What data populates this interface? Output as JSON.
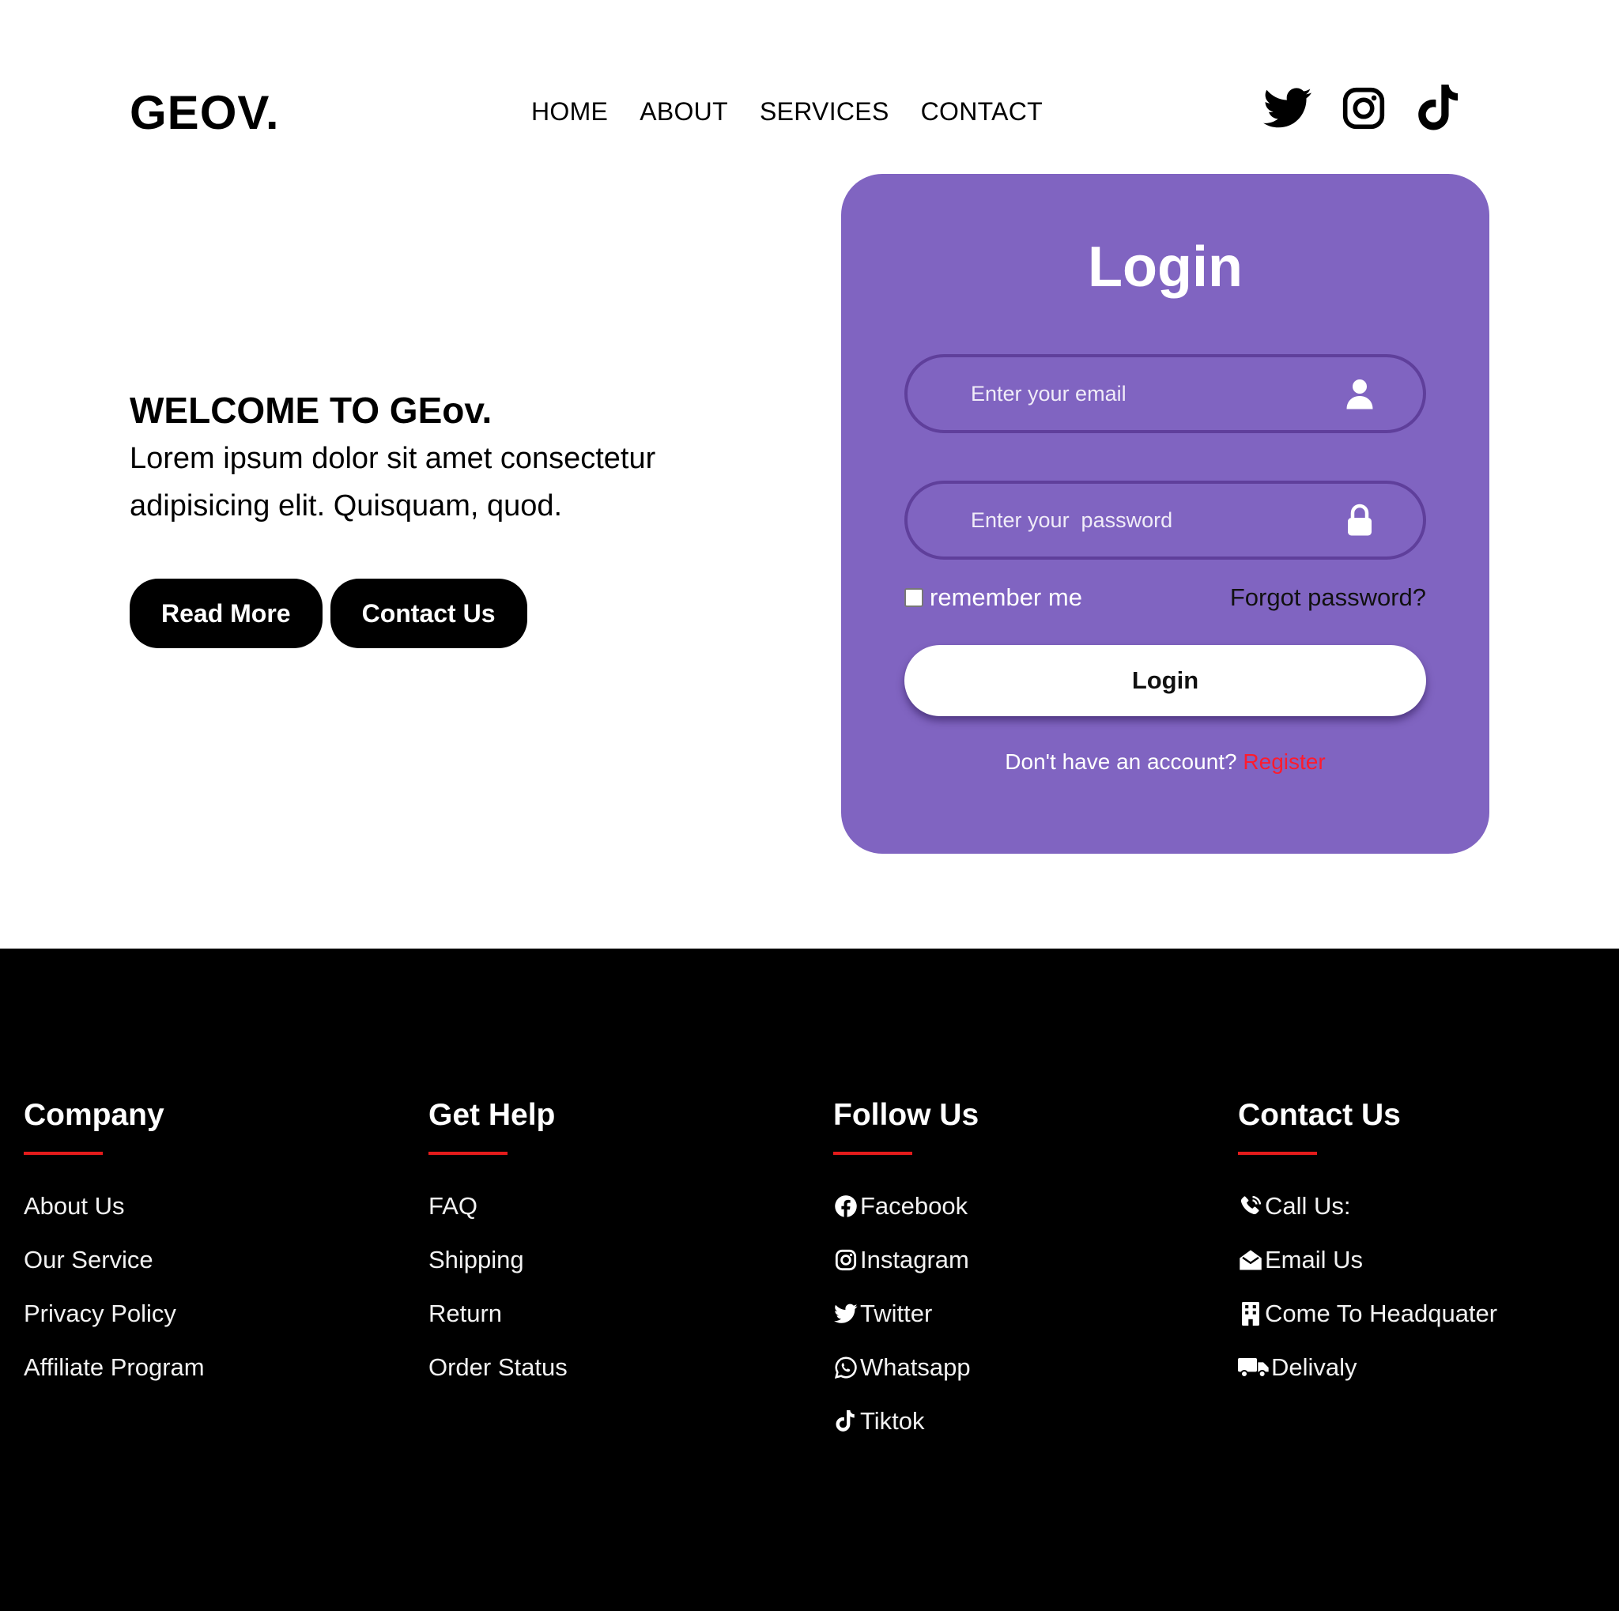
{
  "header": {
    "logo": "GEOV.",
    "nav": [
      "HOME",
      "ABOUT",
      "SERVICES",
      "CONTACT"
    ],
    "social_icons": [
      "twitter-icon",
      "instagram-icon",
      "tiktok-icon"
    ]
  },
  "hero": {
    "title": "WELCOME TO GEov.",
    "text": "Lorem ipsum dolor sit amet consectetur adipisicing elit. Quisquam, quod.",
    "read_more": "Read More",
    "contact_us": "Contact Us"
  },
  "login": {
    "title": "Login",
    "email_placeholder": "Enter your email",
    "password_placeholder": "Enter your  password",
    "remember": "remember me",
    "forgot": "Forgot password?",
    "button": "Login",
    "no_account": "Don't have an account?",
    "register": "Register",
    "card_color": "#8064c1",
    "register_color": "#ff1b2d"
  },
  "footer": {
    "company": {
      "title": "Company",
      "items": [
        "About Us",
        "Our Service",
        "Privacy Policy",
        "Affiliate Program"
      ]
    },
    "help": {
      "title": "Get Help",
      "items": [
        "FAQ",
        "Shipping",
        "Return",
        "Order Status"
      ]
    },
    "follow": {
      "title": "Follow Us",
      "items": [
        "Facebook",
        "Instagram",
        "Twitter",
        "Whatsapp",
        "Tiktok"
      ]
    },
    "contact": {
      "title": "Contact Us",
      "items": [
        "Call Us:",
        "Email Us",
        "Come To Headquater",
        "Delivaly"
      ]
    },
    "accent_color": "#e41b1b"
  }
}
